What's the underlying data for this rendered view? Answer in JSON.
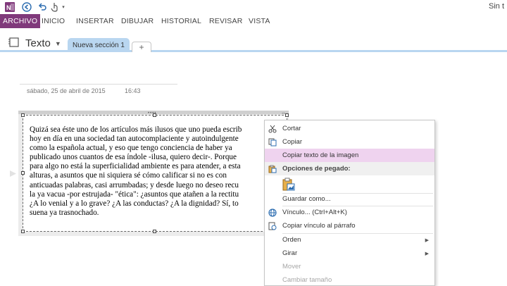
{
  "titlebar": {
    "app_icon": "onenote-logo-icon",
    "back_icon": "back-arrow-icon",
    "undo_icon": "undo-icon",
    "touch_icon": "touch-mode-icon",
    "title": "Sin t"
  },
  "ribbon": {
    "tabs": [
      "ARCHIVO",
      "INICIO",
      "INSERTAR",
      "DIBUJAR",
      "HISTORIAL",
      "REVISAR",
      "VISTA"
    ],
    "active_color": "#80397b"
  },
  "notebook": {
    "name": "Texto",
    "section_tab": "Nueva sección 1",
    "add_tab": "+"
  },
  "page": {
    "date": "sábado, 25 de abril de 2015",
    "time": "16:43"
  },
  "image_text": [
    "Quizá sea éste uno de los artículos más ilusos que uno pueda escrib",
    "hoy en día en una sociedad tan autocomplaciente y autoindulgente",
    "como la española actual, y eso que tengo conciencia de haber ya",
    "publicado unos cuantos de esa índole -ilusa, quiero decir-. Porque",
    "para algo no está la superficialidad ambiente es para atender, a esta",
    "alturas, a asuntos que ni siquiera sé cómo calificar si no es con",
    "anticuadas palabras, casi arrumbadas; y desde luego no deseo recu",
    "la ya vacua -por estrujada- \"ética\": ¿asuntos que atañen a la rectitu",
    "¿A lo venial y a lo grave? ¿A las conductas? ¿A la dignidad? Sí, to",
    "suena ya trasnochado."
  ],
  "context_menu": {
    "cut": "Cortar",
    "copy": "Copiar",
    "copy_image_text": "Copiar texto de la imagen",
    "paste_options": "Opciones de pegado:",
    "save_as": "Guardar como...",
    "link": "Vínculo...  (Ctrl+Alt+K)",
    "copy_paragraph_link": "Copiar vínculo al párrafo",
    "order": "Orden",
    "rotate": "Girar",
    "move": "Mover",
    "resize": "Cambiar tamaño",
    "highlight_color": "#efd3ef"
  }
}
